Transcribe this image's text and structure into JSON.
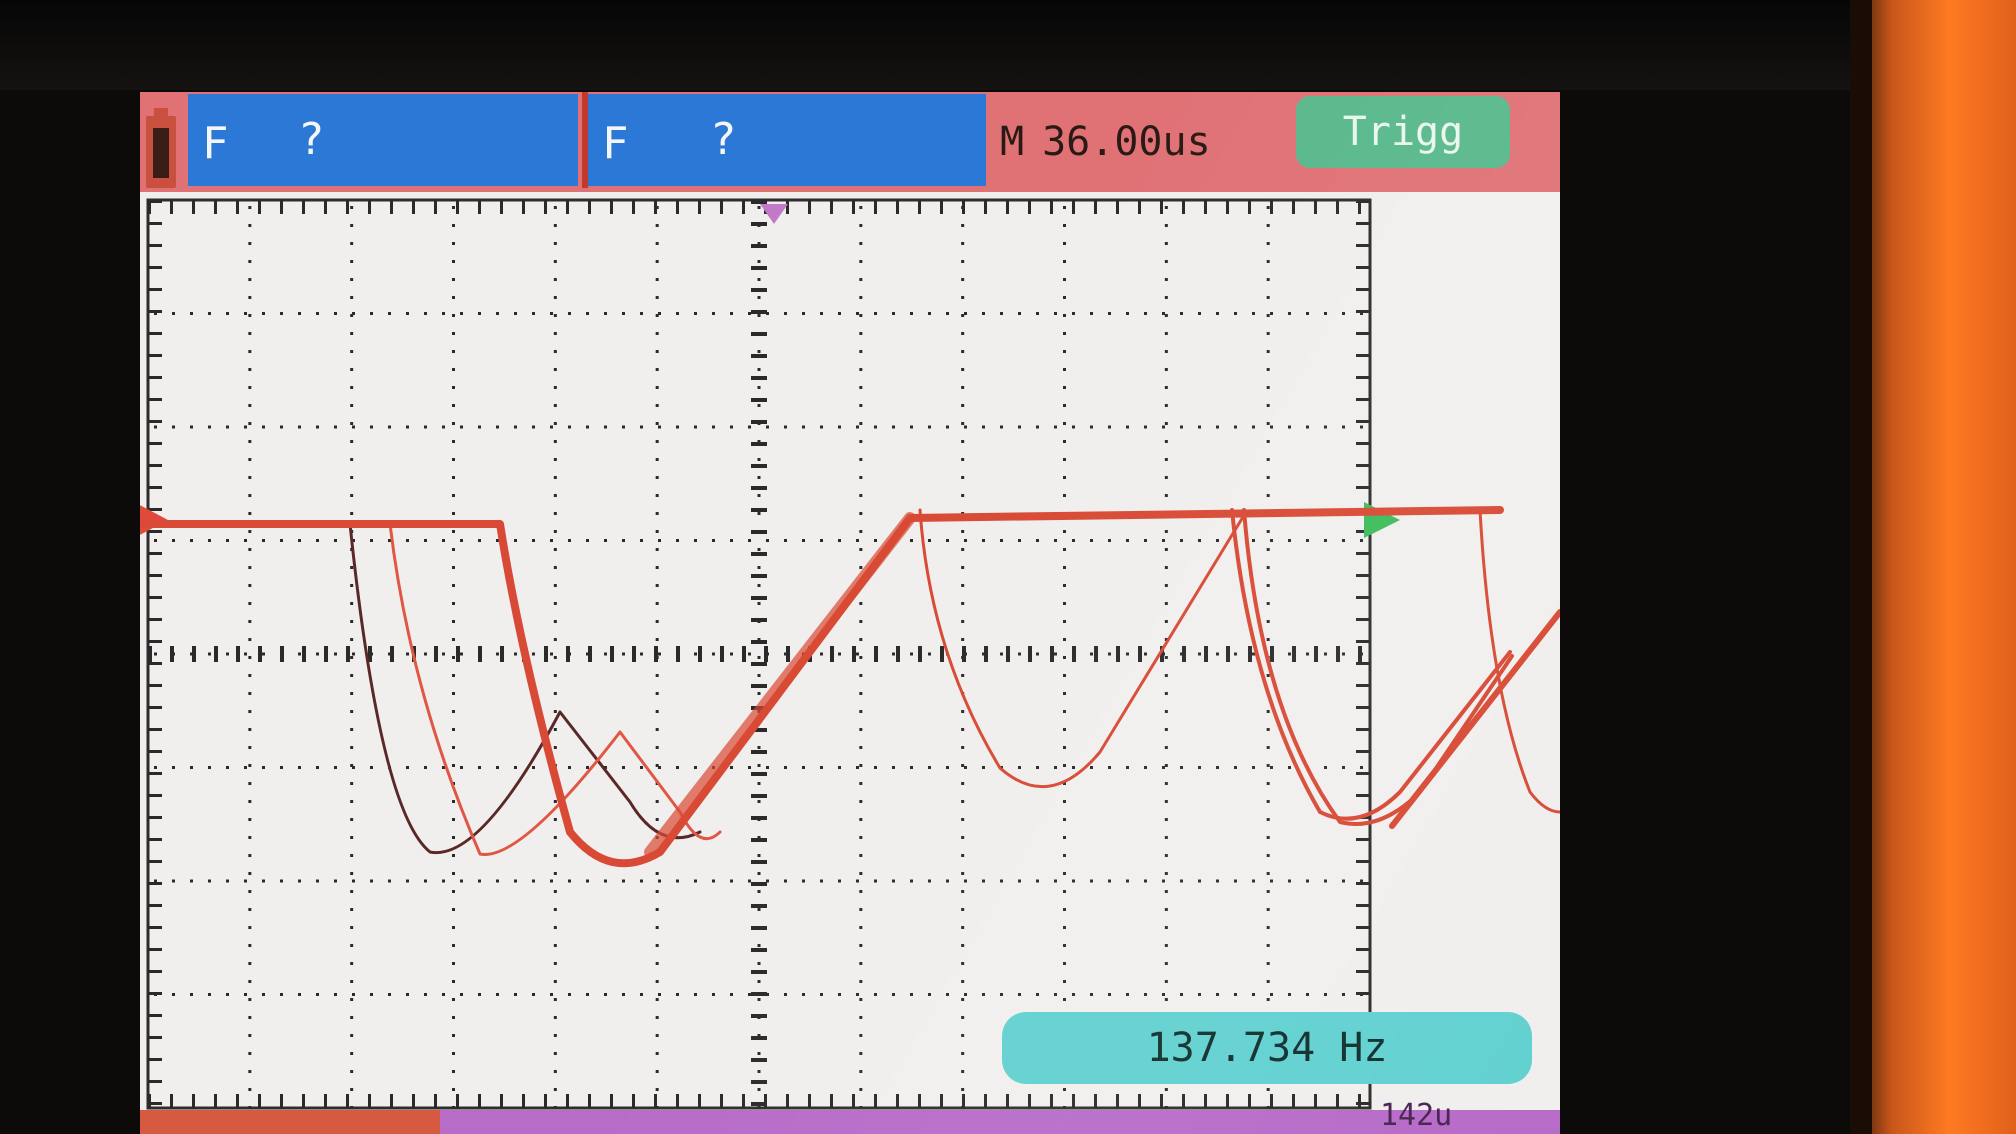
{
  "channel1": {
    "coupling": "F",
    "value": "?"
  },
  "channel2": {
    "coupling": "F",
    "value": "?"
  },
  "timebase": {
    "prefix": "M",
    "value": "36.00us"
  },
  "trigger": {
    "label": "Trigg"
  },
  "measurement": {
    "frequency": "137.734 Hz"
  },
  "bottom_partial_text": "142u",
  "colors": {
    "channel_bar": "#2c78d6",
    "header_bar": "#e07276",
    "trigger_badge": "#5ab98c",
    "frequency_badge": "#62d1d0",
    "trace": "#d84a35",
    "screen_background": "#f1efed"
  }
}
